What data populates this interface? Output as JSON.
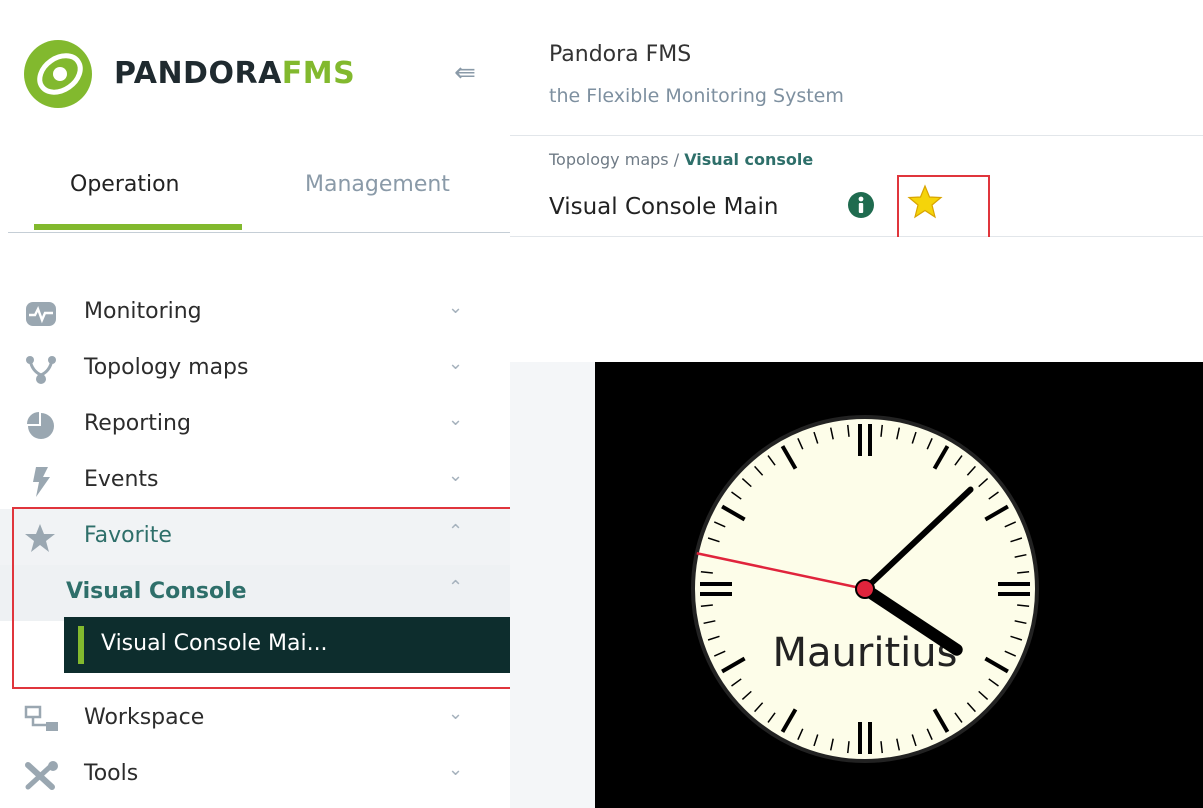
{
  "brand": {
    "name_part1": "PANDORA",
    "name_part2": "FMS",
    "accent_color": "#82b92e",
    "dark_color": "#0d2d2d",
    "teal_color": "#2e6f6a"
  },
  "sidebar": {
    "collapse_icon": "collapse-arrow-icon",
    "tabs": [
      {
        "label": "Operation",
        "active": true
      },
      {
        "label": "Management",
        "active": false
      }
    ],
    "items": [
      {
        "label": "Monitoring",
        "icon": "heartbeat-monitor-icon"
      },
      {
        "label": "Topology maps",
        "icon": "network-topology-icon"
      },
      {
        "label": "Reporting",
        "icon": "pie-chart-icon"
      },
      {
        "label": "Events",
        "icon": "lightning-icon"
      },
      {
        "label": "Favorite",
        "icon": "star-icon",
        "expanded": true
      },
      {
        "label": "Workspace",
        "icon": "workspace-icon"
      },
      {
        "label": "Tools",
        "icon": "wrench-screwdriver-icon"
      }
    ],
    "favorite": {
      "group_label": "Visual Console",
      "active_item": "Visual Console Mai..."
    },
    "chevron_down": "⌄",
    "chevron_up": "^"
  },
  "header": {
    "app_title": "Pandora FMS",
    "app_subtitle": "the Flexible Monitoring System"
  },
  "page": {
    "breadcrumb_parent": "Topology maps / ",
    "breadcrumb_current": "Visual console",
    "title": "Visual Console Main",
    "info_icon": "info-circle-icon",
    "favorite_icon": "favorite-star-icon",
    "favorite_color": "#f5d40a"
  },
  "clock": {
    "label": "Mauritius",
    "hour": 4,
    "minute": 7,
    "second": 47,
    "face_color": "#fdfde9",
    "second_hand_color": "#e0243c"
  }
}
